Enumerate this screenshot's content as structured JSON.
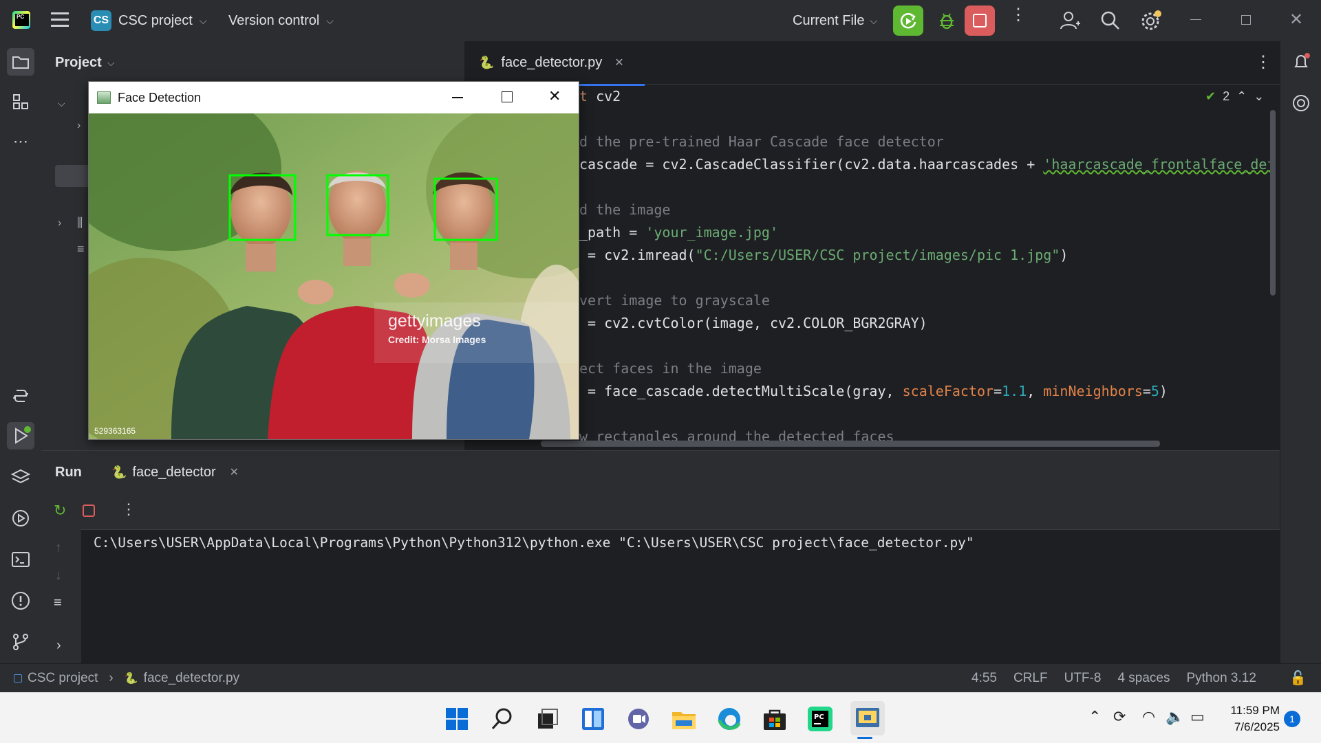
{
  "titlebar": {
    "project_badge": "CS",
    "project_name": "CSC project",
    "vcs": "Version control",
    "run_config": "Current File"
  },
  "project_panel": {
    "title": "Project"
  },
  "editor": {
    "tab": "face_detector.py",
    "problems_count": "2",
    "lines": [
      {
        "t": "t cv2",
        "k": "kw"
      },
      {
        "t": "",
        "k": ""
      },
      {
        "t": "d the pre-trained Haar Cascade face detector",
        "k": "cm"
      },
      {
        "t": "cascade = cv2.CascadeClassifier(cv2.data.haarcascades + 'haarcascade_frontalface_defa",
        "k": "mix1"
      },
      {
        "t": "",
        "k": ""
      },
      {
        "t": "d the image",
        "k": "cm"
      },
      {
        "t": "_path = 'your_image.jpg'",
        "k": "mix2"
      },
      {
        "t": " = cv2.imread(\"C:/Users/USER/CSC project/images/pic 1.jpg\")",
        "k": "mix3"
      },
      {
        "t": "",
        "k": ""
      },
      {
        "t": "vert image to grayscale",
        "k": "cm"
      },
      {
        "t": " = cv2.cvtColor(image, cv2.COLOR_BGR2GRAY)",
        "k": ""
      },
      {
        "t": "",
        "k": ""
      },
      {
        "t": "ect faces in the image",
        "k": "cm"
      },
      {
        "t": " = face_cascade.detectMultiScale(gray, scaleFactor=1.1, minNeighbors=5)",
        "k": "mix4"
      },
      {
        "t": "",
        "k": ""
      },
      {
        "t": "w rectangles around the detected faces",
        "k": "cm"
      }
    ]
  },
  "run_panel": {
    "title": "Run",
    "tab": "face_detector",
    "output": "C:\\Users\\USER\\AppData\\Local\\Programs\\Python\\Python312\\python.exe \"C:\\Users\\USER\\CSC project\\face_detector.py\""
  },
  "statusbar": {
    "project": "CSC project",
    "file": "face_detector.py",
    "position": "4:55",
    "line_sep": "CRLF",
    "encoding": "UTF-8",
    "indent": "4 spaces",
    "interpreter": "Python 3.12"
  },
  "face_window": {
    "title": "Face Detection",
    "watermark_brand": "gettyimages",
    "watermark_credit": "Credit: Morsa Images",
    "image_id": "529363165",
    "faces_detected": 3
  },
  "taskbar": {
    "time": "11:59 PM",
    "date": "7/6/2025",
    "notification_count": "1"
  },
  "colors": {
    "accent_green": "#5fb832",
    "stop_red": "#db5c5c",
    "detection_box": "#00ff00"
  }
}
